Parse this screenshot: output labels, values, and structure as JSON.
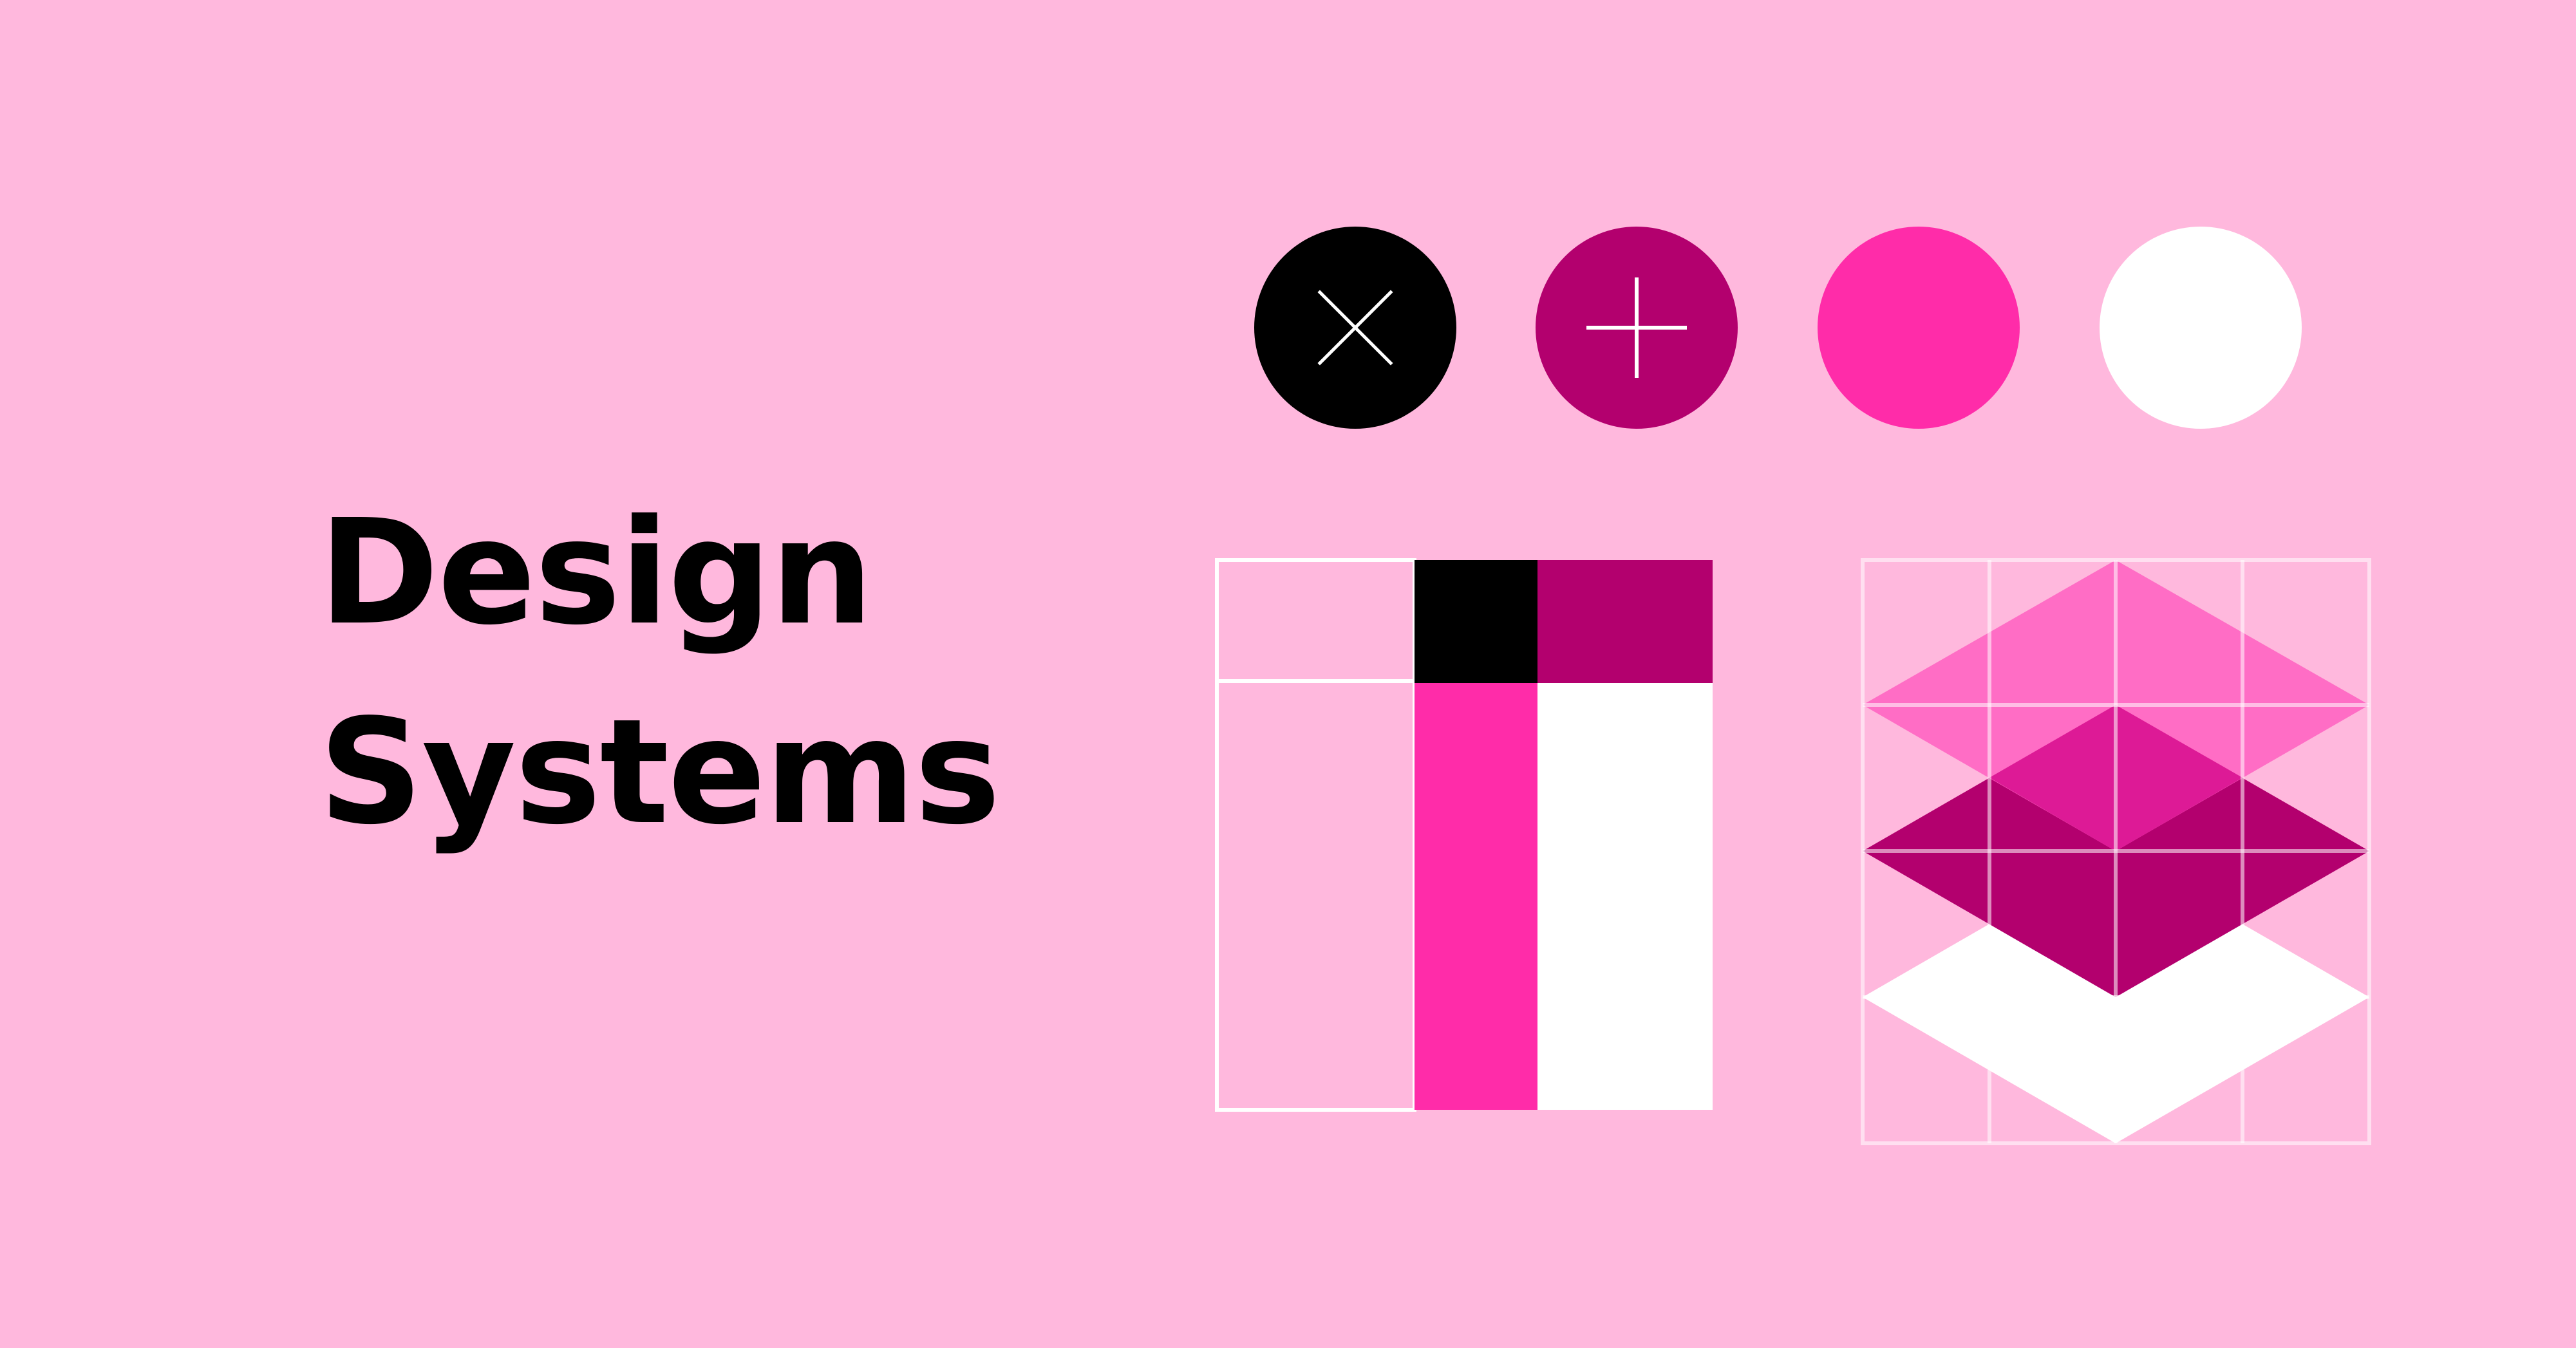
{
  "title": {
    "line1": "Design",
    "line2": "Systems"
  },
  "swatches": [
    {
      "name": "black",
      "color": "#000000",
      "icon": "close-icon"
    },
    {
      "name": "magenta",
      "color": "#B3006E",
      "icon": "plus-icon"
    },
    {
      "name": "hot-pink",
      "color": "#FF2CA9",
      "icon": ""
    },
    {
      "name": "white",
      "color": "#FFFFFF",
      "icon": ""
    }
  ],
  "colors": {
    "background": "#FFB8DD",
    "black": "#000000",
    "magenta": "#B3006E",
    "hot_pink": "#FF2CA9",
    "white": "#FFFFFF",
    "light_pink_layer": "#FF66C2",
    "mid_pink_layer": "#DD1A96",
    "grid_line": "#FFFFFF"
  }
}
